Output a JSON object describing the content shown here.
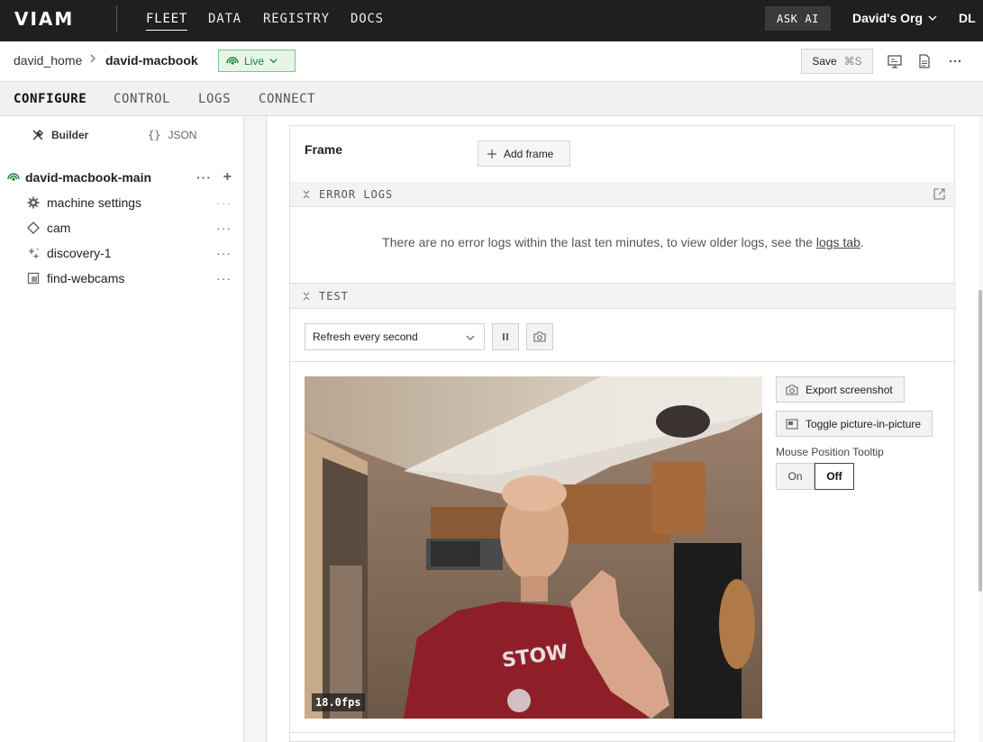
{
  "topnav": {
    "logo_text": "VIAM",
    "links": [
      {
        "label": "FLEET",
        "active": true
      },
      {
        "label": "DATA",
        "active": false
      },
      {
        "label": "REGISTRY",
        "active": false
      },
      {
        "label": "DOCS",
        "active": false
      }
    ],
    "ask_ai_label": "ASK AI",
    "org_label": "David's Org",
    "user_initials": "DL"
  },
  "subheader": {
    "location": "david_home",
    "machine": "david-macbook",
    "status_label": "Live",
    "save_label": "Save",
    "save_shortcut": "⌘S"
  },
  "tabs": [
    {
      "label": "CONFIGURE",
      "active": true
    },
    {
      "label": "CONTROL",
      "active": false
    },
    {
      "label": "LOGS",
      "active": false
    },
    {
      "label": "CONNECT",
      "active": false
    }
  ],
  "sidebar": {
    "mode_builder": "Builder",
    "mode_json": "JSON",
    "json_glyph": "{}",
    "root_part": "david-macbook-main",
    "items": [
      {
        "label": "machine settings",
        "icon": "gear-icon"
      },
      {
        "label": "cam",
        "icon": "diamond-icon"
      },
      {
        "label": "discovery-1",
        "icon": "sparkle-icon"
      },
      {
        "label": "find-webcams",
        "icon": "module-icon"
      }
    ]
  },
  "main": {
    "frame_label": "Frame",
    "add_frame_label": "Add frame",
    "error_logs_title": "ERROR LOGS",
    "error_logs_message": "There are no error logs within the last ten minutes, to view older logs, see the",
    "error_logs_link": "logs tab",
    "error_logs_end": ".",
    "test_title": "TEST",
    "refresh_value": "Refresh every second",
    "fps_label": "18.0fps",
    "export_screenshot_label": "Export screenshot",
    "toggle_pip_label": "Toggle picture-in-picture",
    "mouse_tooltip_label": "Mouse Position Tooltip",
    "tooltip_on_label": "On",
    "tooltip_off_label": "Off",
    "tooltip_selected": "Off"
  },
  "colors": {
    "nav_bg": "#1f1f1f",
    "live_green": "#1e7f35",
    "live_bg": "#e6f5e8"
  }
}
